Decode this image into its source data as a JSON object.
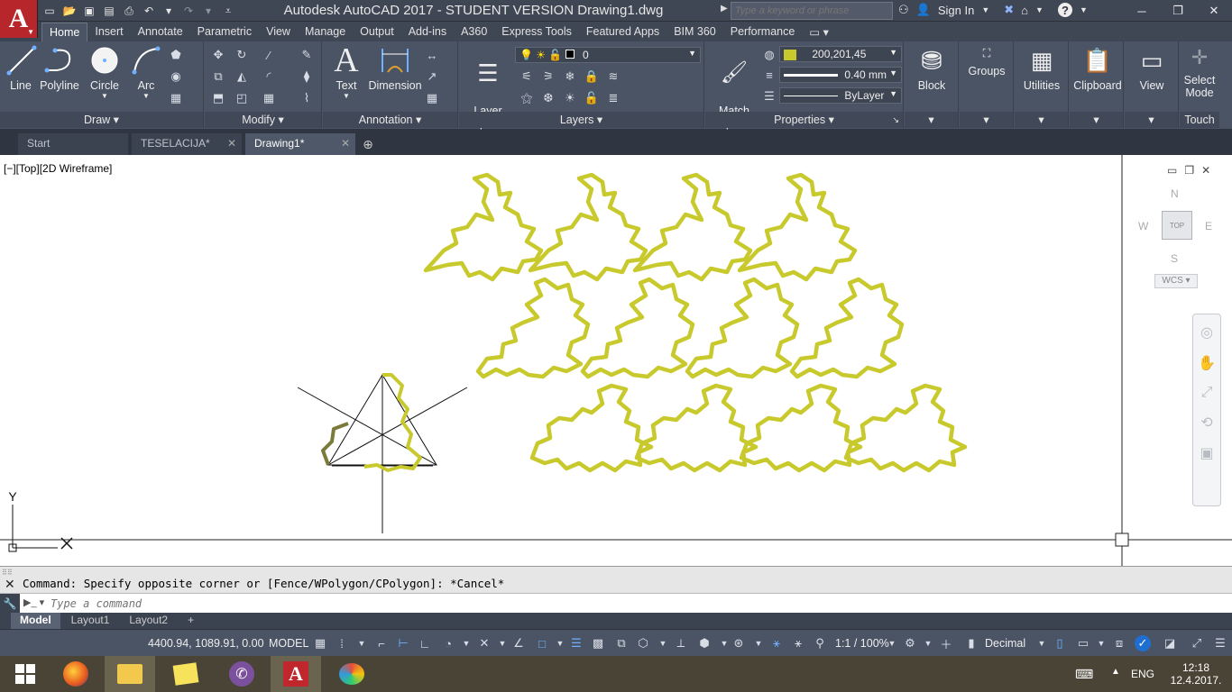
{
  "window": {
    "title": "Autodesk AutoCAD 2017 - STUDENT VERSION    Drawing1.dwg"
  },
  "app_logo": "A",
  "search": {
    "placeholder": "Type a keyword or phrase"
  },
  "account": {
    "signin_label": "Sign In"
  },
  "ribbon_tabs": [
    "Home",
    "Insert",
    "Annotate",
    "Parametric",
    "View",
    "Manage",
    "Output",
    "Add-ins",
    "A360",
    "Express Tools",
    "Featured Apps",
    "BIM 360",
    "Performance"
  ],
  "draw_panel": {
    "title": "Draw",
    "line": "Line",
    "polyline": "Polyline",
    "circle": "Circle",
    "arc": "Arc"
  },
  "modify_panel": {
    "title": "Modify"
  },
  "annotation_panel": {
    "title": "Annotation",
    "text": "Text",
    "dimension": "Dimension"
  },
  "layers_panel": {
    "title": "Layers",
    "layer_properties": "Layer\nProperties",
    "current_layer": "0"
  },
  "properties_panel": {
    "title": "Properties",
    "match_properties": "Match\nProperties",
    "color_value": "200,201,45",
    "color_hex": "#c8c92d",
    "lineweight": "0.40 mm",
    "linetype": "ByLayer"
  },
  "right_panels": {
    "block": "Block",
    "groups": "Groups",
    "utilities": "Utilities",
    "clipboard": "Clipboard",
    "view": "View",
    "select_mode": "Select\nMode",
    "touch": "Touch"
  },
  "document_tabs": [
    {
      "label": "Start"
    },
    {
      "label": "TESELACIJA*"
    },
    {
      "label": "Drawing1*"
    }
  ],
  "viewport": {
    "label": "[−][Top][2D Wireframe]",
    "ucs_y": "Y",
    "viewcube": {
      "n": "N",
      "s": "S",
      "e": "E",
      "w": "W",
      "top": "TOP",
      "wcs": "WCS"
    }
  },
  "command": {
    "history": "Command: Specify opposite corner or [Fence/WPolygon/CPolygon]: *Cancel*",
    "placeholder": "Type a command"
  },
  "layout_tabs": [
    "Model",
    "Layout1",
    "Layout2"
  ],
  "status": {
    "coords": "4400.94, 1089.91, 0.00",
    "mode": "MODEL",
    "scale": "1:1 / 100%",
    "units": "Decimal"
  },
  "taskbar": {
    "lang": "ENG",
    "time": "12:18",
    "date": "12.4.2017."
  }
}
